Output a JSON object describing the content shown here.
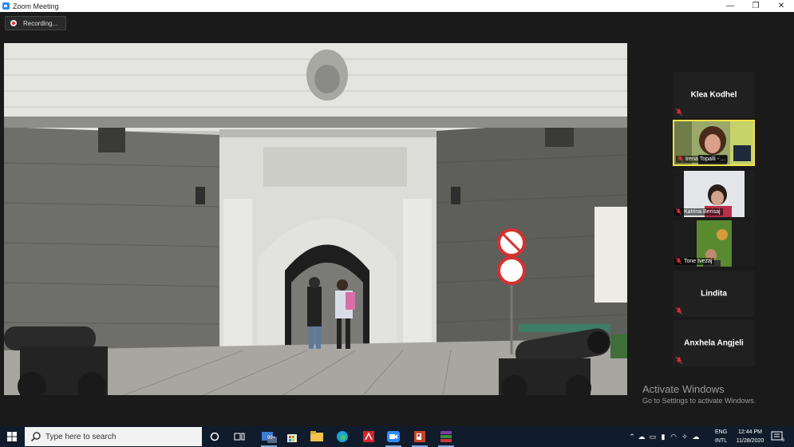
{
  "window": {
    "title": "Zoom Meeting",
    "controls": [
      "—",
      "❐",
      "✕"
    ]
  },
  "recording": {
    "label": "Recording..."
  },
  "participants": [
    {
      "name": "Klea Kodhel",
      "video": false,
      "muted": true
    },
    {
      "name": "Irena Topalli - ...",
      "video": true,
      "muted": true,
      "active_speaker": true
    },
    {
      "name": "Katrina Berisaj",
      "video": true,
      "muted": true
    },
    {
      "name": "Tone Ivezaj",
      "video": true,
      "muted": true
    },
    {
      "name": "Lindita",
      "video": false,
      "muted": true
    },
    {
      "name": "Anxhela Angjeli",
      "video": false,
      "muted": true
    }
  ],
  "watermark": {
    "title": "Activate Windows",
    "subtitle": "Go to Settings to activate Windows."
  },
  "taskbar": {
    "search_placeholder": "Type here to search",
    "badge": "99+",
    "lang_top": "ENG",
    "lang_bottom": "INTL",
    "time": "12:44 PM",
    "date": "11/28/2020",
    "notification_count": "6"
  },
  "colors": {
    "active_speaker_border": "#f4e24a",
    "muted_icon": "#e0303a",
    "taskbar": "#101c2c",
    "zoom_blue": "#2d8cff"
  }
}
